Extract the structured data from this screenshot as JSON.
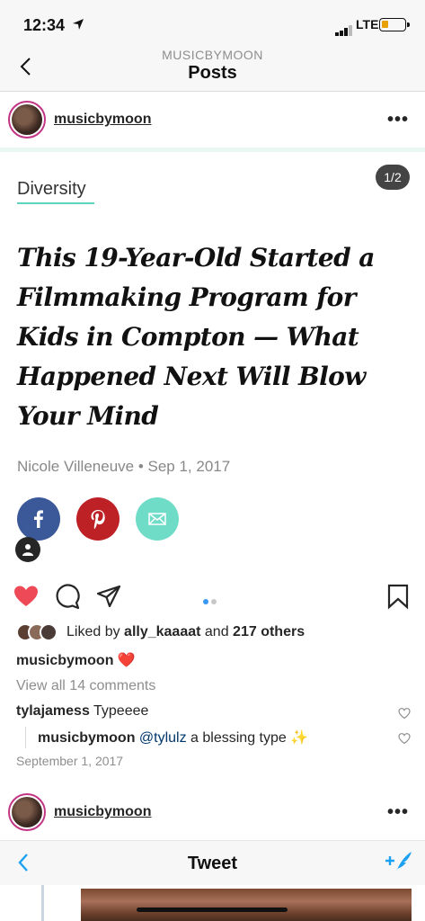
{
  "status_bar": {
    "time": "12:34",
    "network": "LTE"
  },
  "header": {
    "subtitle": "MUSICBYMOON",
    "title": "Posts"
  },
  "post1": {
    "username": "musicbymoon",
    "more": "•••",
    "image": {
      "tag": "Diversity",
      "counter": "1/2",
      "headline": "This 19-Year-Old Started a Filmmaking Program for Kids in Compton — What Happened Next Will Blow Your Mind",
      "byline": "Nicole Villeneuve  •  Sep 1, 2017"
    },
    "likes": {
      "prefix": "Liked by ",
      "user": "ally_kaaaat",
      "middle": " and ",
      "count": "217 others"
    },
    "caption_user": "musicbymoon",
    "caption_text": "❤️",
    "view_all": "View all 14 comments",
    "comments": [
      {
        "user": "tylajamess",
        "text": " Typeeee",
        "mention": ""
      },
      {
        "user": "musicbymoon",
        "mention": " @tylulz",
        "text": " a blessing type ✨"
      }
    ],
    "date": "September 1, 2017"
  },
  "post2": {
    "username": "musicbymoon",
    "more": "•••",
    "tweet_title": "Tweet"
  },
  "colors": {
    "like_red": "#ed4956",
    "facebook": "#3b5998",
    "pinterest": "#bd2126",
    "mail": "#6fdcc8",
    "twitter_blue": "#1da1f2"
  }
}
